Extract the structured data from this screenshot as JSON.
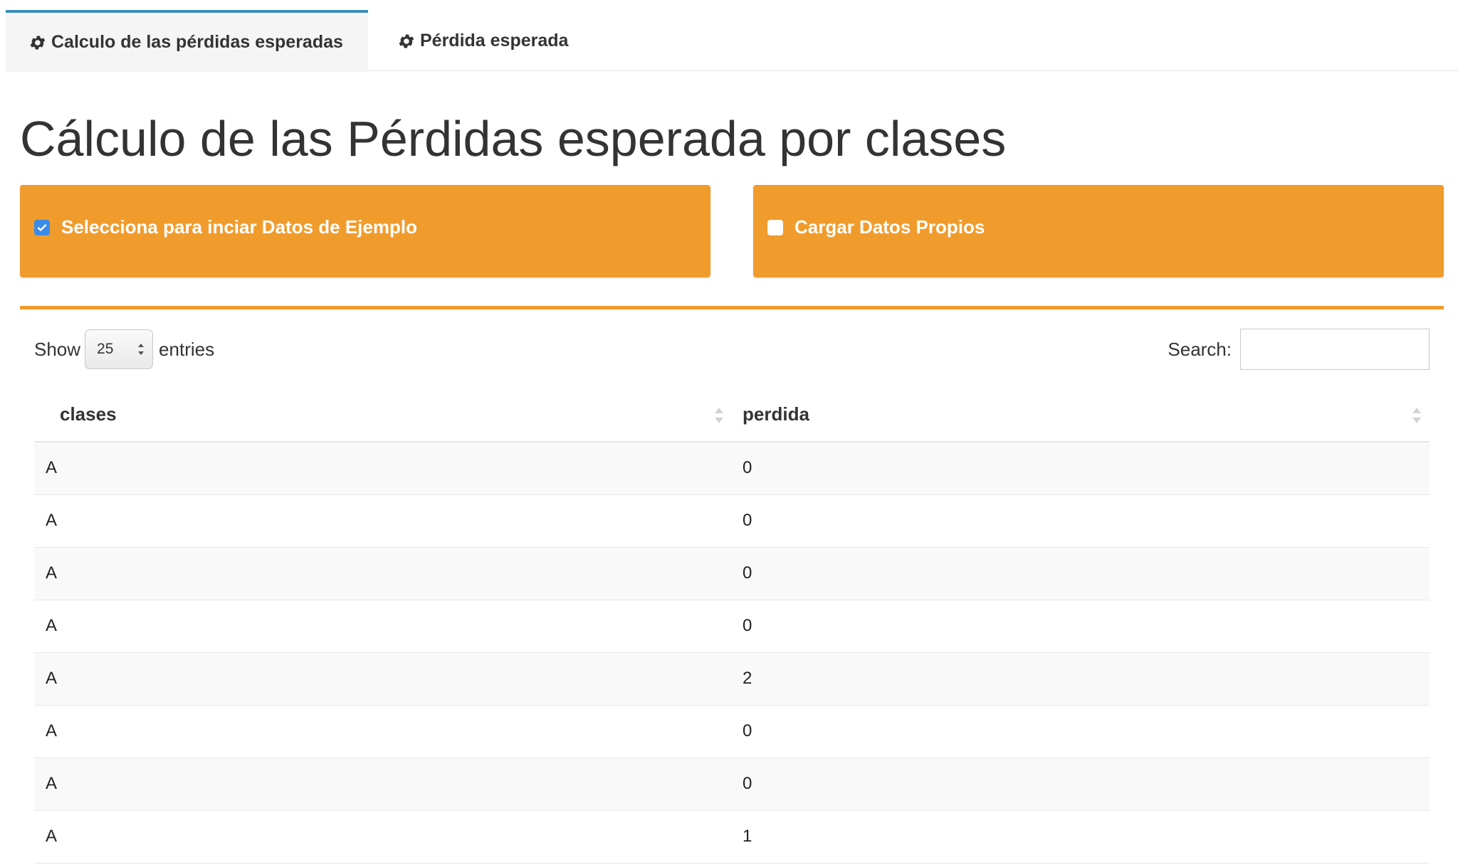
{
  "tabs": [
    {
      "label": "Calculo de las pérdidas esperadas",
      "icon": "gear-icon",
      "active": true
    },
    {
      "label": "Pérdida esperada",
      "icon": "gear-icon",
      "active": false
    }
  ],
  "page_title": "Cálculo de las Pérdidas esperada por clases",
  "options": {
    "sample_data": {
      "label": "Selecciona para inciar Datos de Ejemplo",
      "checked": true
    },
    "own_data": {
      "label": "Cargar Datos Propios",
      "checked": false
    }
  },
  "table_controls": {
    "show_label": "Show",
    "page_length": "25",
    "entries_label": "entries",
    "search_label": "Search:",
    "search_value": ""
  },
  "table": {
    "columns": [
      "clases",
      "perdida"
    ],
    "rows": [
      [
        "A",
        "0"
      ],
      [
        "A",
        "0"
      ],
      [
        "A",
        "0"
      ],
      [
        "A",
        "0"
      ],
      [
        "A",
        "2"
      ],
      [
        "A",
        "0"
      ],
      [
        "A",
        "0"
      ],
      [
        "A",
        "1"
      ]
    ]
  },
  "colors": {
    "accent_orange": "#f09c2d",
    "tab_accent": "#3c8dbc",
    "checkbox_blue": "#3b8be8"
  }
}
